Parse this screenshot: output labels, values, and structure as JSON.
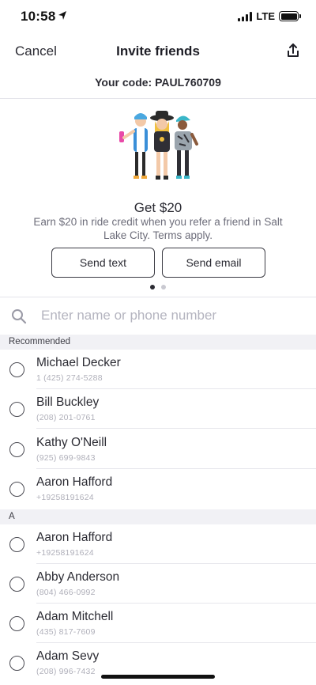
{
  "status": {
    "time": "10:58",
    "network": "LTE"
  },
  "nav": {
    "cancel_label": "Cancel",
    "title": "Invite friends",
    "share_icon": "share-icon"
  },
  "referral": {
    "code_text": "Your code: PAUL760709"
  },
  "promo": {
    "title": "Get $20",
    "description": "Earn $20 in ride credit when you refer a friend in Salt Lake City. Terms apply.",
    "send_text_label": "Send text",
    "send_email_label": "Send email",
    "page_count": 2,
    "active_page": 1
  },
  "search": {
    "placeholder": "Enter name or phone number",
    "value": ""
  },
  "sections": {
    "recommended": {
      "header": "Recommended",
      "contacts": [
        {
          "name": "Michael Decker",
          "phone": "1 (425) 274-5288"
        },
        {
          "name": "Bill Buckley",
          "phone": "(208) 201-0761"
        },
        {
          "name": "Kathy O'Neill",
          "phone": "(925) 699-9843"
        },
        {
          "name": "Aaron Hafford",
          "phone": "+19258191624"
        }
      ]
    },
    "a": {
      "header": "A",
      "contacts": [
        {
          "name": "Aaron Hafford",
          "phone": "+19258191624"
        },
        {
          "name": "Abby Anderson",
          "phone": "(804) 466-0992"
        },
        {
          "name": "Adam Mitchell",
          "phone": "(435) 817-7609"
        },
        {
          "name": "Adam Sevy",
          "phone": "(208) 996-7432"
        }
      ]
    }
  },
  "colors": {
    "text": "#2b2b33",
    "muted": "#6d6d7a",
    "phone": "#b0b0ba",
    "section_bg": "#f1f1f5",
    "hat": "#2a2a2a",
    "cap": "#3ab6c8"
  }
}
